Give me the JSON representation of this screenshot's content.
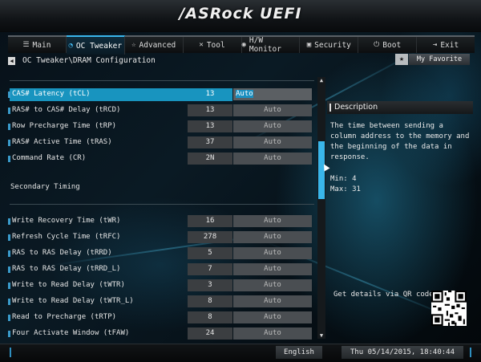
{
  "logo": "/ASRock UEFI",
  "tabs": [
    {
      "icon": "☰",
      "label": "Main",
      "active": false
    },
    {
      "icon": "◔",
      "label": "OC Tweaker",
      "active": true
    },
    {
      "icon": "☆",
      "label": "Advanced",
      "active": false
    },
    {
      "icon": "✕",
      "label": "Tool",
      "active": false
    },
    {
      "icon": "◉",
      "label": "H/W Monitor",
      "active": false
    },
    {
      "icon": "▣",
      "label": "Security",
      "active": false
    },
    {
      "icon": "⏻",
      "label": "Boot",
      "active": false
    },
    {
      "icon": "⇥",
      "label": "Exit",
      "active": false
    }
  ],
  "breadcrumb": "OC Tweaker\\DRAM Configuration",
  "favorite": {
    "icon": "★",
    "label": "My Favorite"
  },
  "rows_primary": [
    {
      "label": "CAS# Latency (tCL)",
      "value": "13",
      "setting": "Auto",
      "selected": true
    },
    {
      "label": "RAS# to CAS# Delay (tRCD)",
      "value": "13",
      "setting": "Auto"
    },
    {
      "label": "Row Precharge Time (tRP)",
      "value": "13",
      "setting": "Auto"
    },
    {
      "label": "RAS# Active Time (tRAS)",
      "value": "37",
      "setting": "Auto"
    },
    {
      "label": "Command Rate (CR)",
      "value": "2N",
      "setting": "Auto"
    }
  ],
  "section_title": "Secondary Timing",
  "rows_secondary": [
    {
      "label": "Write Recovery Time (tWR)",
      "value": "16",
      "setting": "Auto"
    },
    {
      "label": "Refresh Cycle Time (tRFC)",
      "value": "278",
      "setting": "Auto"
    },
    {
      "label": "RAS to RAS Delay (tRRD)",
      "value": "5",
      "setting": "Auto"
    },
    {
      "label": "RAS to RAS Delay (tRRD_L)",
      "value": "7",
      "setting": "Auto"
    },
    {
      "label": "Write to Read Delay (tWTR)",
      "value": "3",
      "setting": "Auto"
    },
    {
      "label": "Write to Read Delay (tWTR_L)",
      "value": "8",
      "setting": "Auto"
    },
    {
      "label": "Read to Precharge (tRTP)",
      "value": "8",
      "setting": "Auto"
    },
    {
      "label": "Four Activate Window (tFAW)",
      "value": "24",
      "setting": "Auto"
    }
  ],
  "description": {
    "title": "Description",
    "text": "The time between sending a column address to the memory and the beginning of the data in response.",
    "min": "Min: 4",
    "max": "Max: 31"
  },
  "qr_text": "Get details via QR code",
  "language": "English",
  "datetime": "Thu 05/14/2015, 18:40:44",
  "colors": {
    "accent": "#1894bf",
    "scroll": "#39b6ea",
    "field": "#3b3e41",
    "auto": "#4a4e52"
  }
}
